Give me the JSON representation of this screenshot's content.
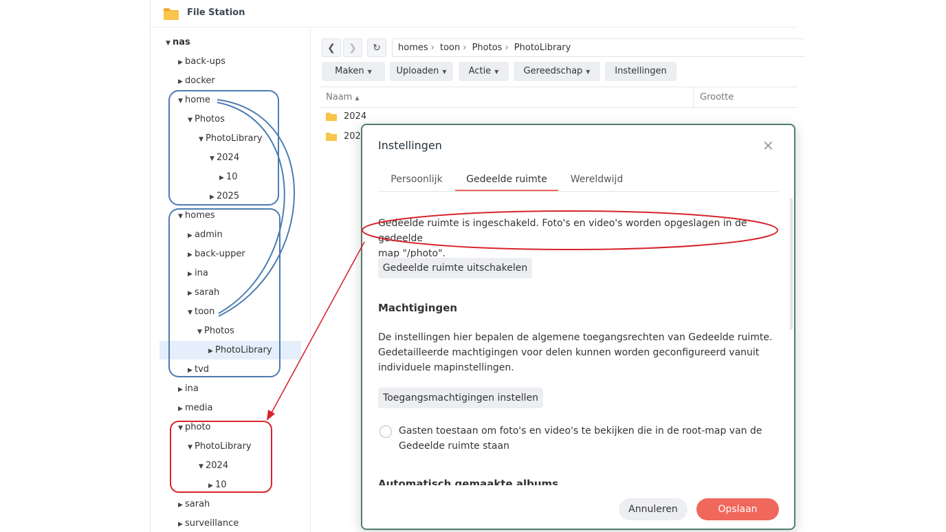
{
  "app": {
    "title": "File Station"
  },
  "tree": [
    {
      "label": "nas",
      "expanded": true
    },
    {
      "label": "back-ups",
      "expanded": false
    },
    {
      "label": "docker",
      "expanded": false
    },
    {
      "label": "home",
      "expanded": true
    },
    {
      "label": "Photos",
      "expanded": true
    },
    {
      "label": "PhotoLibrary",
      "expanded": true
    },
    {
      "label": "2024",
      "expanded": true
    },
    {
      "label": "10",
      "expanded": false
    },
    {
      "label": "2025",
      "expanded": false
    },
    {
      "label": "homes",
      "expanded": true
    },
    {
      "label": "admin",
      "expanded": false
    },
    {
      "label": "back-upper",
      "expanded": false
    },
    {
      "label": "ina",
      "expanded": false
    },
    {
      "label": "sarah",
      "expanded": false
    },
    {
      "label": "toon",
      "expanded": true
    },
    {
      "label": "Photos",
      "expanded": true
    },
    {
      "label": "PhotoLibrary",
      "expanded": false,
      "selected": true
    },
    {
      "label": "tvd",
      "expanded": false
    },
    {
      "label": "ina",
      "expanded": false
    },
    {
      "label": "media",
      "expanded": false
    },
    {
      "label": "photo",
      "expanded": true
    },
    {
      "label": "PhotoLibrary",
      "expanded": true
    },
    {
      "label": "2024",
      "expanded": true
    },
    {
      "label": "10",
      "expanded": false
    },
    {
      "label": "sarah",
      "expanded": false
    },
    {
      "label": "surveillance",
      "expanded": false
    }
  ],
  "path": [
    "homes",
    "toon",
    "Photos",
    "PhotoLibrary"
  ],
  "toolbar": {
    "create": "Maken",
    "upload": "Uploaden",
    "action": "Actie",
    "tools": "Gereedschap",
    "settings": "Instellingen"
  },
  "list": {
    "col_name": "Naam",
    "col_size": "Grootte",
    "rows": [
      "2024",
      "202"
    ]
  },
  "dialog": {
    "title": "Instellingen",
    "tabs": [
      "Persoonlijk",
      "Gedeelde ruimte",
      "Wereldwijd"
    ],
    "active_tab": "Gedeelde ruimte",
    "info_line1": "Gedeelde ruimte is ingeschakeld. Foto's en video's worden opgeslagen in de gedeelde",
    "info_line2": "map \"/photo\".",
    "disable_button": "Gedeelde ruimte uitschakelen",
    "permissions_heading": "Machtigingen",
    "permissions_line1": "De instellingen hier bepalen de algemene toegangsrechten van Gedeelde ruimte.",
    "permissions_line2": "Gedetailleerde machtigingen voor delen kunnen worden geconfigureerd vanuit",
    "permissions_line3": "individuele mapinstellingen.",
    "permissions_button": "Toegangsmachtigingen instellen",
    "guest_line1": "Gasten toestaan om foto's en video's te bekijken die in de root-map van de",
    "guest_line2": "Gedeelde ruimte staan",
    "guest_checked": false,
    "albums_heading": "Automatisch gemaakte albums",
    "cancel": "Annuleren",
    "save": "Opslaan"
  },
  "colors": {
    "accent": "#f0675b",
    "annotation_blue": "#4a7bb0",
    "annotation_red": "#d7232b",
    "selected_row": "#e4effb",
    "folder": "#f7c54a"
  }
}
